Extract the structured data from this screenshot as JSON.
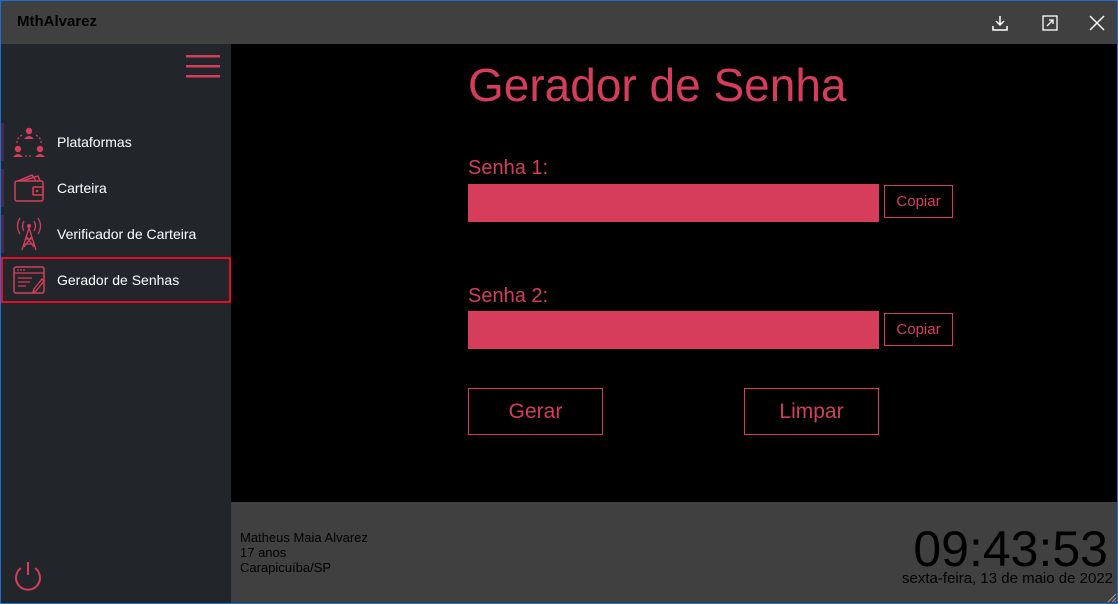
{
  "window": {
    "title": "MthAlvarez"
  },
  "titlebar": {
    "buttons": [
      {
        "icon": "download-icon"
      },
      {
        "icon": "maximize-icon"
      },
      {
        "icon": "close-icon"
      }
    ]
  },
  "sidebar": {
    "menu_icon": "hamburger-menu-icon",
    "items": [
      {
        "label": "Plataformas",
        "icon": "users-network-icon"
      },
      {
        "label": "Carteira",
        "icon": "wallet-icon"
      },
      {
        "label": "Verificador de Carteira",
        "icon": "antenna-tower-icon"
      },
      {
        "label": "Gerador de Senhas",
        "icon": "password-form-icon",
        "active": true
      }
    ],
    "power_icon": "power-icon"
  },
  "main": {
    "title": "Gerador de Senha",
    "fields": [
      {
        "label": "Senha 1:",
        "value": "",
        "copy_label": "Copiar"
      },
      {
        "label": "Senha 2:",
        "value": "",
        "copy_label": "Copiar"
      }
    ],
    "generate_label": "Gerar",
    "clear_label": "Limpar"
  },
  "footer": {
    "user_name": "Matheus Maia Alvarez",
    "user_age": "17 anos",
    "user_city": "Carapicuíba/SP",
    "time": "09:43:53",
    "date": "sexta-feira, 13 de maio de 2022"
  },
  "colors": {
    "accent": "#d63d5a",
    "titlebar": "#404040",
    "sidebar": "#22262b",
    "selection_border": "#e0102a"
  }
}
